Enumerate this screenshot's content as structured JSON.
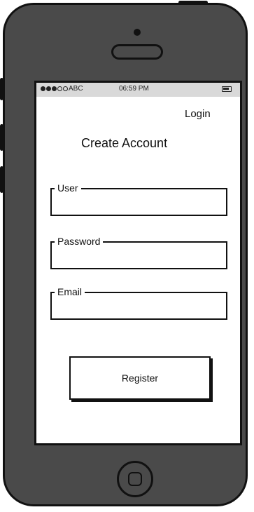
{
  "status_bar": {
    "carrier": "ABC",
    "time": "06:59 PM",
    "signal_bars_filled": 3,
    "signal_bars_total": 5,
    "battery_icon": "battery-icon"
  },
  "header": {
    "login_link": "Login",
    "title": "Create Account"
  },
  "form": {
    "fields": [
      {
        "label": "User",
        "value": ""
      },
      {
        "label": "Password",
        "value": ""
      },
      {
        "label": "Email",
        "value": ""
      }
    ],
    "register_label": "Register"
  },
  "colors": {
    "device_body": "#4a4a4a",
    "outline": "#111111",
    "status_bar_bg": "#d9d9d9",
    "screen_bg": "#ffffff"
  }
}
